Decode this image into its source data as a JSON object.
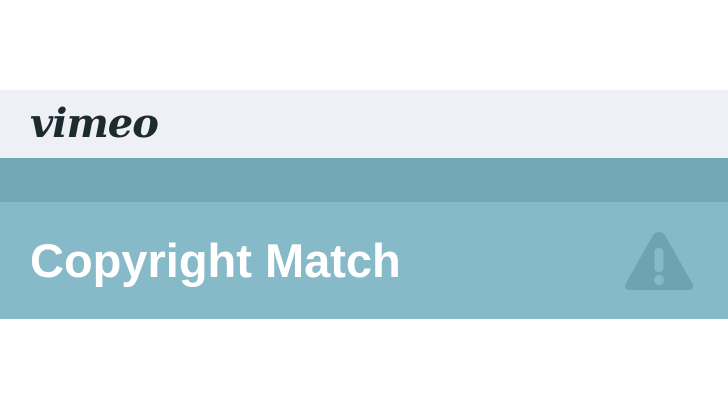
{
  "header": {
    "logo_text": "vimeo"
  },
  "banner": {
    "title": "Copyright Match",
    "icon": "warning-icon",
    "colors": {
      "header_bg": "#eff0f5",
      "stripe": "#73a7b6",
      "banner_bg": "#87bac9",
      "icon": "#6ea3b2"
    }
  }
}
